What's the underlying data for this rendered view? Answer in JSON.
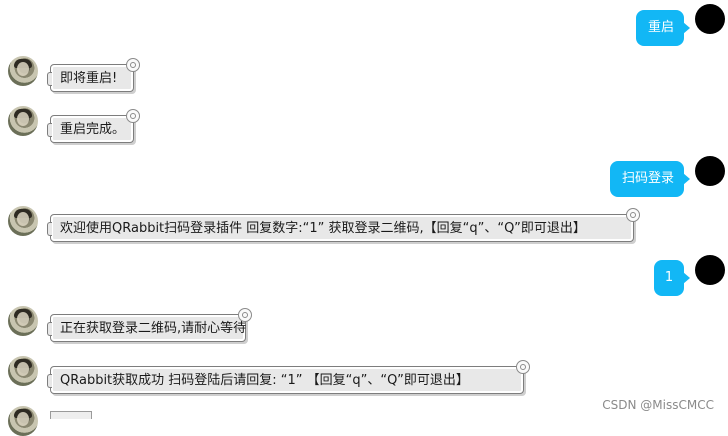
{
  "messages": [
    {
      "side": "right",
      "text": "重启"
    },
    {
      "side": "left",
      "text": "即将重启!"
    },
    {
      "side": "left",
      "text": "重启完成。"
    },
    {
      "side": "right",
      "text": "扫码登录"
    },
    {
      "side": "left",
      "text": "欢迎使用QRabbit扫码登录插件  回复数字:“1”   获取登录二维码,【回复“q”、“Q”即可退出】"
    },
    {
      "side": "right",
      "text": "1"
    },
    {
      "side": "left",
      "text": "正在获取登录二维码,请耐心等待"
    },
    {
      "side": "left",
      "text": "QRabbit获取成功  扫码登陆后请回复: “1”   【回复“q”、“Q”即可退出】"
    }
  ],
  "watermark": "CSDN @MissCMCC",
  "colors": {
    "user_bubble": "#12b7f5",
    "bot_bubble": "#e8e8e8",
    "avatar_user": "#000000"
  }
}
